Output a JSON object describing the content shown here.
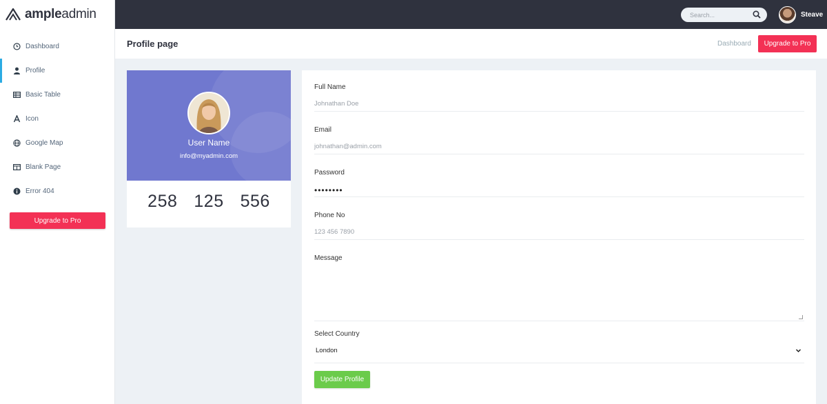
{
  "brand": {
    "bold": "ample",
    "light": "admin"
  },
  "sidebar": {
    "items": [
      {
        "label": "Dashboard",
        "icon": "clock-icon"
      },
      {
        "label": "Profile",
        "icon": "user-icon"
      },
      {
        "label": "Basic Table",
        "icon": "table-icon"
      },
      {
        "label": "Icon",
        "icon": "font-icon"
      },
      {
        "label": "Google Map",
        "icon": "globe-icon"
      },
      {
        "label": "Blank Page",
        "icon": "columns-icon"
      },
      {
        "label": "Error 404",
        "icon": "info-circle-icon"
      }
    ],
    "upgrade_label": "Upgrade to Pro"
  },
  "topbar": {
    "search_placeholder": "Search...",
    "user_name": "Steave"
  },
  "titlebar": {
    "title": "Profile page",
    "breadcrumb": "Dashboard",
    "upgrade_label": "Upgrade to Pro"
  },
  "profile": {
    "name": "User Name",
    "email": "info@myadmin.com",
    "stats": [
      "258",
      "125",
      "556"
    ]
  },
  "form": {
    "full_name": {
      "label": "Full Name",
      "value": "Johnathan Doe"
    },
    "email": {
      "label": "Email",
      "value": "johnathan@admin.com"
    },
    "password": {
      "label": "Password",
      "value": "••••••••"
    },
    "phone": {
      "label": "Phone No",
      "value": "123 456 7890"
    },
    "message": {
      "label": "Message",
      "value": ""
    },
    "country": {
      "label": "Select Country",
      "value": "London"
    },
    "submit_label": "Update Profile"
  },
  "colors": {
    "sidebar_bg": "#ffffff",
    "topbar_bg": "#2f323e",
    "accent_red": "#f33155",
    "active_blue": "#2cabe3",
    "profile_bg": "#7078cf",
    "button_green": "#6bcb4b",
    "page_bg": "#edf1f5"
  }
}
